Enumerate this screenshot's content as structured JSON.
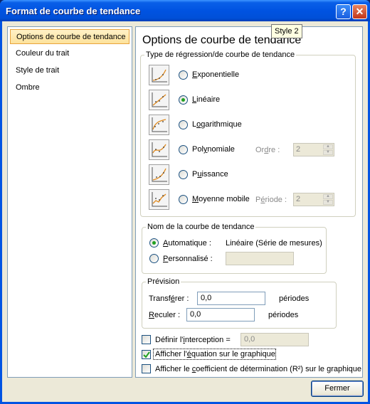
{
  "window": {
    "title": "Format de courbe de tendance",
    "help_glyph": "?",
    "close_glyph": "✕"
  },
  "nav": {
    "items": [
      {
        "label": "Options de courbe de tendance",
        "selected": true
      },
      {
        "label": "Couleur du trait",
        "selected": false
      },
      {
        "label": "Style de trait",
        "selected": false
      },
      {
        "label": "Ombre",
        "selected": false
      }
    ]
  },
  "panel": {
    "heading": "Options de courbe de tendance",
    "tooltip": "Style 2",
    "regression": {
      "legend": "Type de régression/de courbe de tendance",
      "options": [
        {
          "pre": "",
          "key": "E",
          "post": "xponentielle",
          "icon": "exponential-icon",
          "checked": false
        },
        {
          "pre": "",
          "key": "L",
          "post": "inéaire",
          "icon": "linear-icon",
          "checked": true
        },
        {
          "pre": "L",
          "key": "o",
          "post": "garithmique",
          "icon": "logarithmic-icon",
          "checked": false
        },
        {
          "pre": "Pol",
          "key": "y",
          "post": "nomiale",
          "icon": "polynomial-icon",
          "checked": false
        },
        {
          "pre": "P",
          "key": "u",
          "post": "issance",
          "icon": "power-icon",
          "checked": false
        },
        {
          "pre": "",
          "key": "M",
          "post": "oyenne mobile",
          "icon": "moving-average-icon",
          "checked": false
        }
      ],
      "order_pre": "Or",
      "order_key": "d",
      "order_post": "re :",
      "order_value": "2",
      "period_pre": "P",
      "period_key": "é",
      "period_post": "riode :",
      "period_value": "2"
    },
    "name_group": {
      "legend": "Nom de la courbe de tendance",
      "auto_key": "A",
      "auto_post": "utomatique :",
      "auto_checked": true,
      "auto_value": "Linéaire (Série de mesures)",
      "custom_key": "P",
      "custom_post": "ersonnalisé :",
      "custom_checked": false,
      "custom_value": ""
    },
    "forecast": {
      "legend": "Prévision",
      "forward_pre": "Transf",
      "forward_key": "é",
      "forward_post": "rer :",
      "forward_value": "0,0",
      "forward_unit": "périodes",
      "backward_key": "R",
      "backward_post": "eculer :",
      "backward_value": "0,0",
      "backward_unit": "périodes"
    },
    "intercept": {
      "pre": "Définir l'",
      "key": "i",
      "post": "nterception =",
      "checked": false,
      "value": "0,0"
    },
    "show_equation": {
      "pre": "Afficher l'",
      "key": "é",
      "post": "quation sur le graphique",
      "checked": true
    },
    "show_r2": {
      "pre": "Afficher le ",
      "key": "c",
      "post": "oefficient de détermination (R²) sur le graphique",
      "checked": false
    }
  },
  "footer": {
    "close_label": "Fermer"
  },
  "colors": {
    "title_bar": "#0054e3",
    "selection": "#fde29b",
    "radio_dot": "#21a121",
    "dialog_bg": "#ece9d8"
  }
}
